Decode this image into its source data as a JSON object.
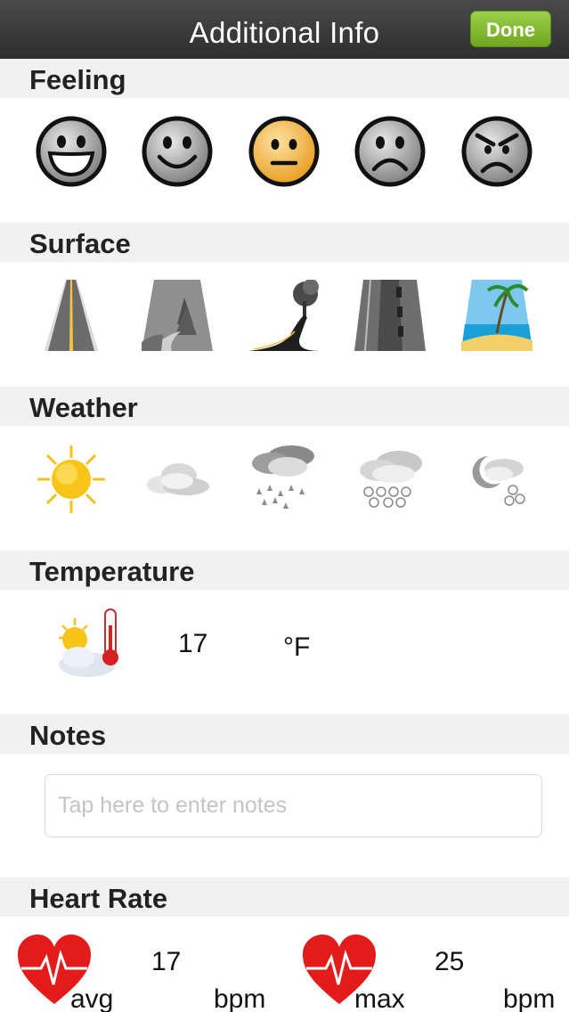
{
  "nav": {
    "title": "Additional Info",
    "done_label": "Done"
  },
  "sections": {
    "feeling": "Feeling",
    "surface": "Surface",
    "weather": "Weather",
    "temperature": "Temperature",
    "notes": "Notes",
    "heart_rate": "Heart Rate"
  },
  "feeling": {
    "options": [
      "very-happy-face-icon",
      "happy-face-icon",
      "neutral-face-icon",
      "sad-face-icon",
      "angry-face-icon"
    ],
    "selected_index": 2
  },
  "surface": {
    "options": [
      "road-icon",
      "trail-icon",
      "winding-road-icon",
      "track-icon",
      "beach-icon"
    ]
  },
  "weather": {
    "options": [
      "sunny-icon",
      "cloudy-icon",
      "rain-icon",
      "snow-icon",
      "night-snow-icon"
    ]
  },
  "temperature": {
    "value": "17",
    "unit": "°F"
  },
  "notes": {
    "placeholder": "Tap here to enter notes"
  },
  "heart_rate": {
    "avg_value": "17",
    "avg_label": "avg",
    "avg_unit": "bpm",
    "max_value": "25",
    "max_label": "max",
    "max_unit": "bpm"
  },
  "colors": {
    "navbar": "#3a3a3a",
    "done": "#7fb82a",
    "selected_face": "#f5b73b",
    "heart": "#e31b1b"
  }
}
